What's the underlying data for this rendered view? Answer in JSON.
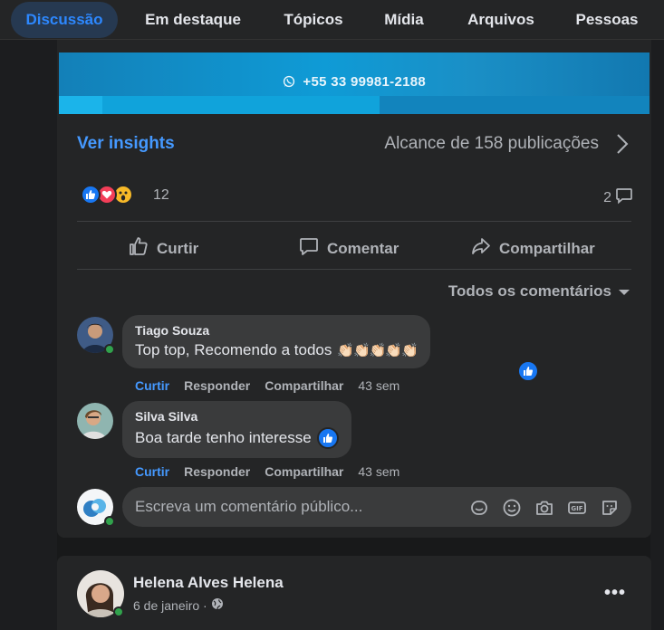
{
  "tabs": [
    {
      "label": "Discussão",
      "active": true
    },
    {
      "label": "Em destaque",
      "active": false
    },
    {
      "label": "Tópicos",
      "active": false
    },
    {
      "label": "Mídia",
      "active": false
    },
    {
      "label": "Arquivos",
      "active": false
    },
    {
      "label": "Pessoas",
      "active": false
    }
  ],
  "post": {
    "banner_phone": "+55 33 99981-2188",
    "ver_insights": "Ver insights",
    "reach": "Alcance de 158 publicações",
    "reaction_count": "12",
    "comment_count": "2",
    "actions": {
      "like": "Curtir",
      "comment": "Comentar",
      "share": "Compartilhar"
    },
    "sort_label": "Todos os comentários"
  },
  "comments": [
    {
      "name": "Tiago Souza",
      "text": "Top top, Recomendo a todos",
      "emoji": "👏🏻👏🏻👏🏻👏🏻👏🏻",
      "like": "Curtir",
      "reply": "Responder",
      "share": "Compartilhar",
      "time": "43 sem"
    },
    {
      "name": "Silva Silva",
      "text": "Boa tarde tenho interesse",
      "like": "Curtir",
      "reply": "Responder",
      "share": "Compartilhar",
      "time": "43 sem"
    }
  ],
  "write_comment": {
    "placeholder": "Escreva um comentário público..."
  },
  "next_post": {
    "author": "Helena Alves Helena",
    "date": "6 de janeiro ·"
  },
  "colors": {
    "accent": "#2d88ff",
    "link": "#4599ff",
    "background": "#18191a",
    "card": "#242526",
    "bubble": "#3a3b3c",
    "online": "#31a24c"
  }
}
